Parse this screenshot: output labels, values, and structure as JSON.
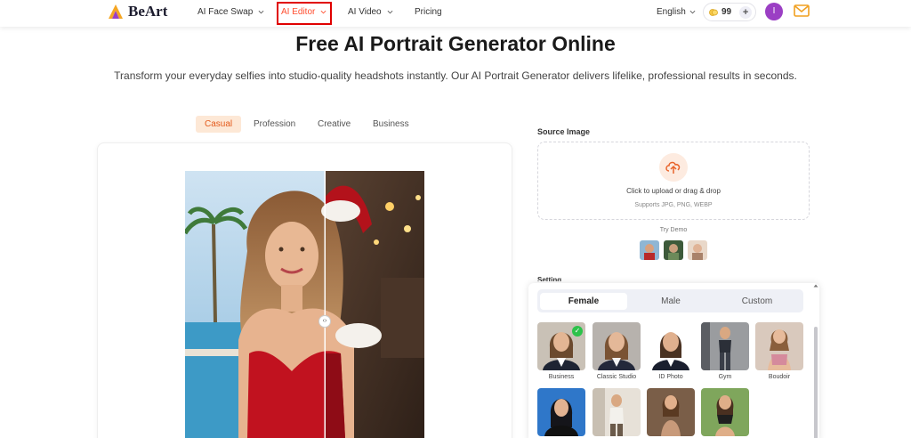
{
  "header": {
    "logo_text": "BeArt",
    "nav": [
      {
        "label": "AI Face Swap"
      },
      {
        "label": "AI Editor"
      },
      {
        "label": "AI Video"
      },
      {
        "label": "Pricing"
      }
    ],
    "language": "English",
    "credits": "99",
    "credits_plus": "+",
    "avatar_initial": "I",
    "accent_color": "#ff4d2e",
    "highlight_color": "#e00000"
  },
  "hero": {
    "title": "Free AI Portrait Generator Online",
    "subtitle": "Transform your everyday selfies into studio-quality headshots instantly. Our AI Portrait Generator delivers lifelike, professional results in seconds."
  },
  "style_tabs": [
    {
      "label": "Casual",
      "active": true
    },
    {
      "label": "Profession",
      "active": false
    },
    {
      "label": "Creative",
      "active": false
    },
    {
      "label": "Business",
      "active": false
    }
  ],
  "source": {
    "label": "Source Image",
    "upload_text": "Click to upload or drag & drop",
    "upload_sub": "Supports JPG, PNG, WEBP",
    "try_demo": "Try Demo",
    "upload_icon": "cloud-upload-icon"
  },
  "settings": {
    "label": "Setting",
    "gender_tabs": [
      {
        "label": "Female",
        "active": true
      },
      {
        "label": "Male",
        "active": false
      },
      {
        "label": "Custom",
        "active": false
      }
    ],
    "presets": [
      {
        "label": "Business",
        "selected": true
      },
      {
        "label": "Classic Studio",
        "selected": false
      },
      {
        "label": "ID Photo",
        "selected": false
      },
      {
        "label": "Gym",
        "selected": false
      },
      {
        "label": "Boudoir",
        "selected": false
      }
    ]
  }
}
